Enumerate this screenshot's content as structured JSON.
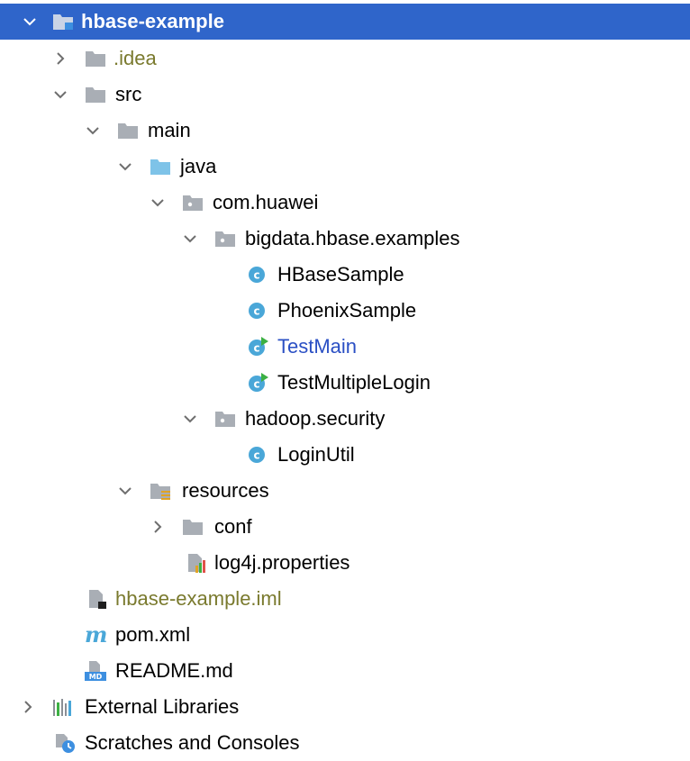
{
  "project_tree": {
    "root": {
      "label": "hbase-example",
      "icon": "module-folder-icon",
      "expanded": true,
      "selected": true
    },
    "idea": {
      "label": ".idea",
      "icon": "folder-icon",
      "expanded": false,
      "color": "#7a7a2e"
    },
    "src": {
      "label": "src",
      "icon": "folder-icon",
      "expanded": true
    },
    "main": {
      "label": "main",
      "icon": "folder-icon",
      "expanded": true
    },
    "java": {
      "label": "java",
      "icon": "source-root-folder-icon",
      "expanded": true
    },
    "com_huawei": {
      "label": "com.huawei",
      "icon": "package-icon",
      "expanded": true
    },
    "examples_pkg": {
      "label": "bigdata.hbase.examples",
      "icon": "package-icon",
      "expanded": true
    },
    "hbase_sample": {
      "label": "HBaseSample",
      "icon": "java-class-icon"
    },
    "phoenix_sample": {
      "label": "PhoenixSample",
      "icon": "java-class-icon"
    },
    "test_main": {
      "label": "TestMain",
      "icon": "java-runnable-class-icon",
      "color": "#2a4fc4"
    },
    "test_multiple_login": {
      "label": "TestMultipleLogin",
      "icon": "java-runnable-class-icon"
    },
    "security_pkg": {
      "label": "hadoop.security",
      "icon": "package-icon",
      "expanded": true
    },
    "login_util": {
      "label": "LoginUtil",
      "icon": "java-class-icon"
    },
    "resources": {
      "label": "resources",
      "icon": "resources-folder-icon",
      "expanded": true
    },
    "conf": {
      "label": "conf",
      "icon": "folder-icon",
      "expanded": false
    },
    "log4j": {
      "label": "log4j.properties",
      "icon": "properties-file-icon"
    },
    "iml": {
      "label": "hbase-example.iml",
      "icon": "iml-file-icon",
      "color": "#7a7a2e"
    },
    "pom": {
      "label": "pom.xml",
      "icon": "maven-icon"
    },
    "readme": {
      "label": "README.md",
      "icon": "markdown-file-icon"
    },
    "external_libraries": {
      "label": "External Libraries",
      "icon": "library-icon",
      "expanded": false
    },
    "scratches": {
      "label": "Scratches and Consoles",
      "icon": "scratches-icon"
    }
  },
  "colors": {
    "selection": "#2f65ca",
    "folder": "#a9aeb5",
    "source_root": "#7ec3e8",
    "class_icon": "#4aa7d8",
    "run_marker": "#3cb043",
    "ignored_text": "#7a7a2e",
    "highlight_text": "#2a4fc4"
  }
}
